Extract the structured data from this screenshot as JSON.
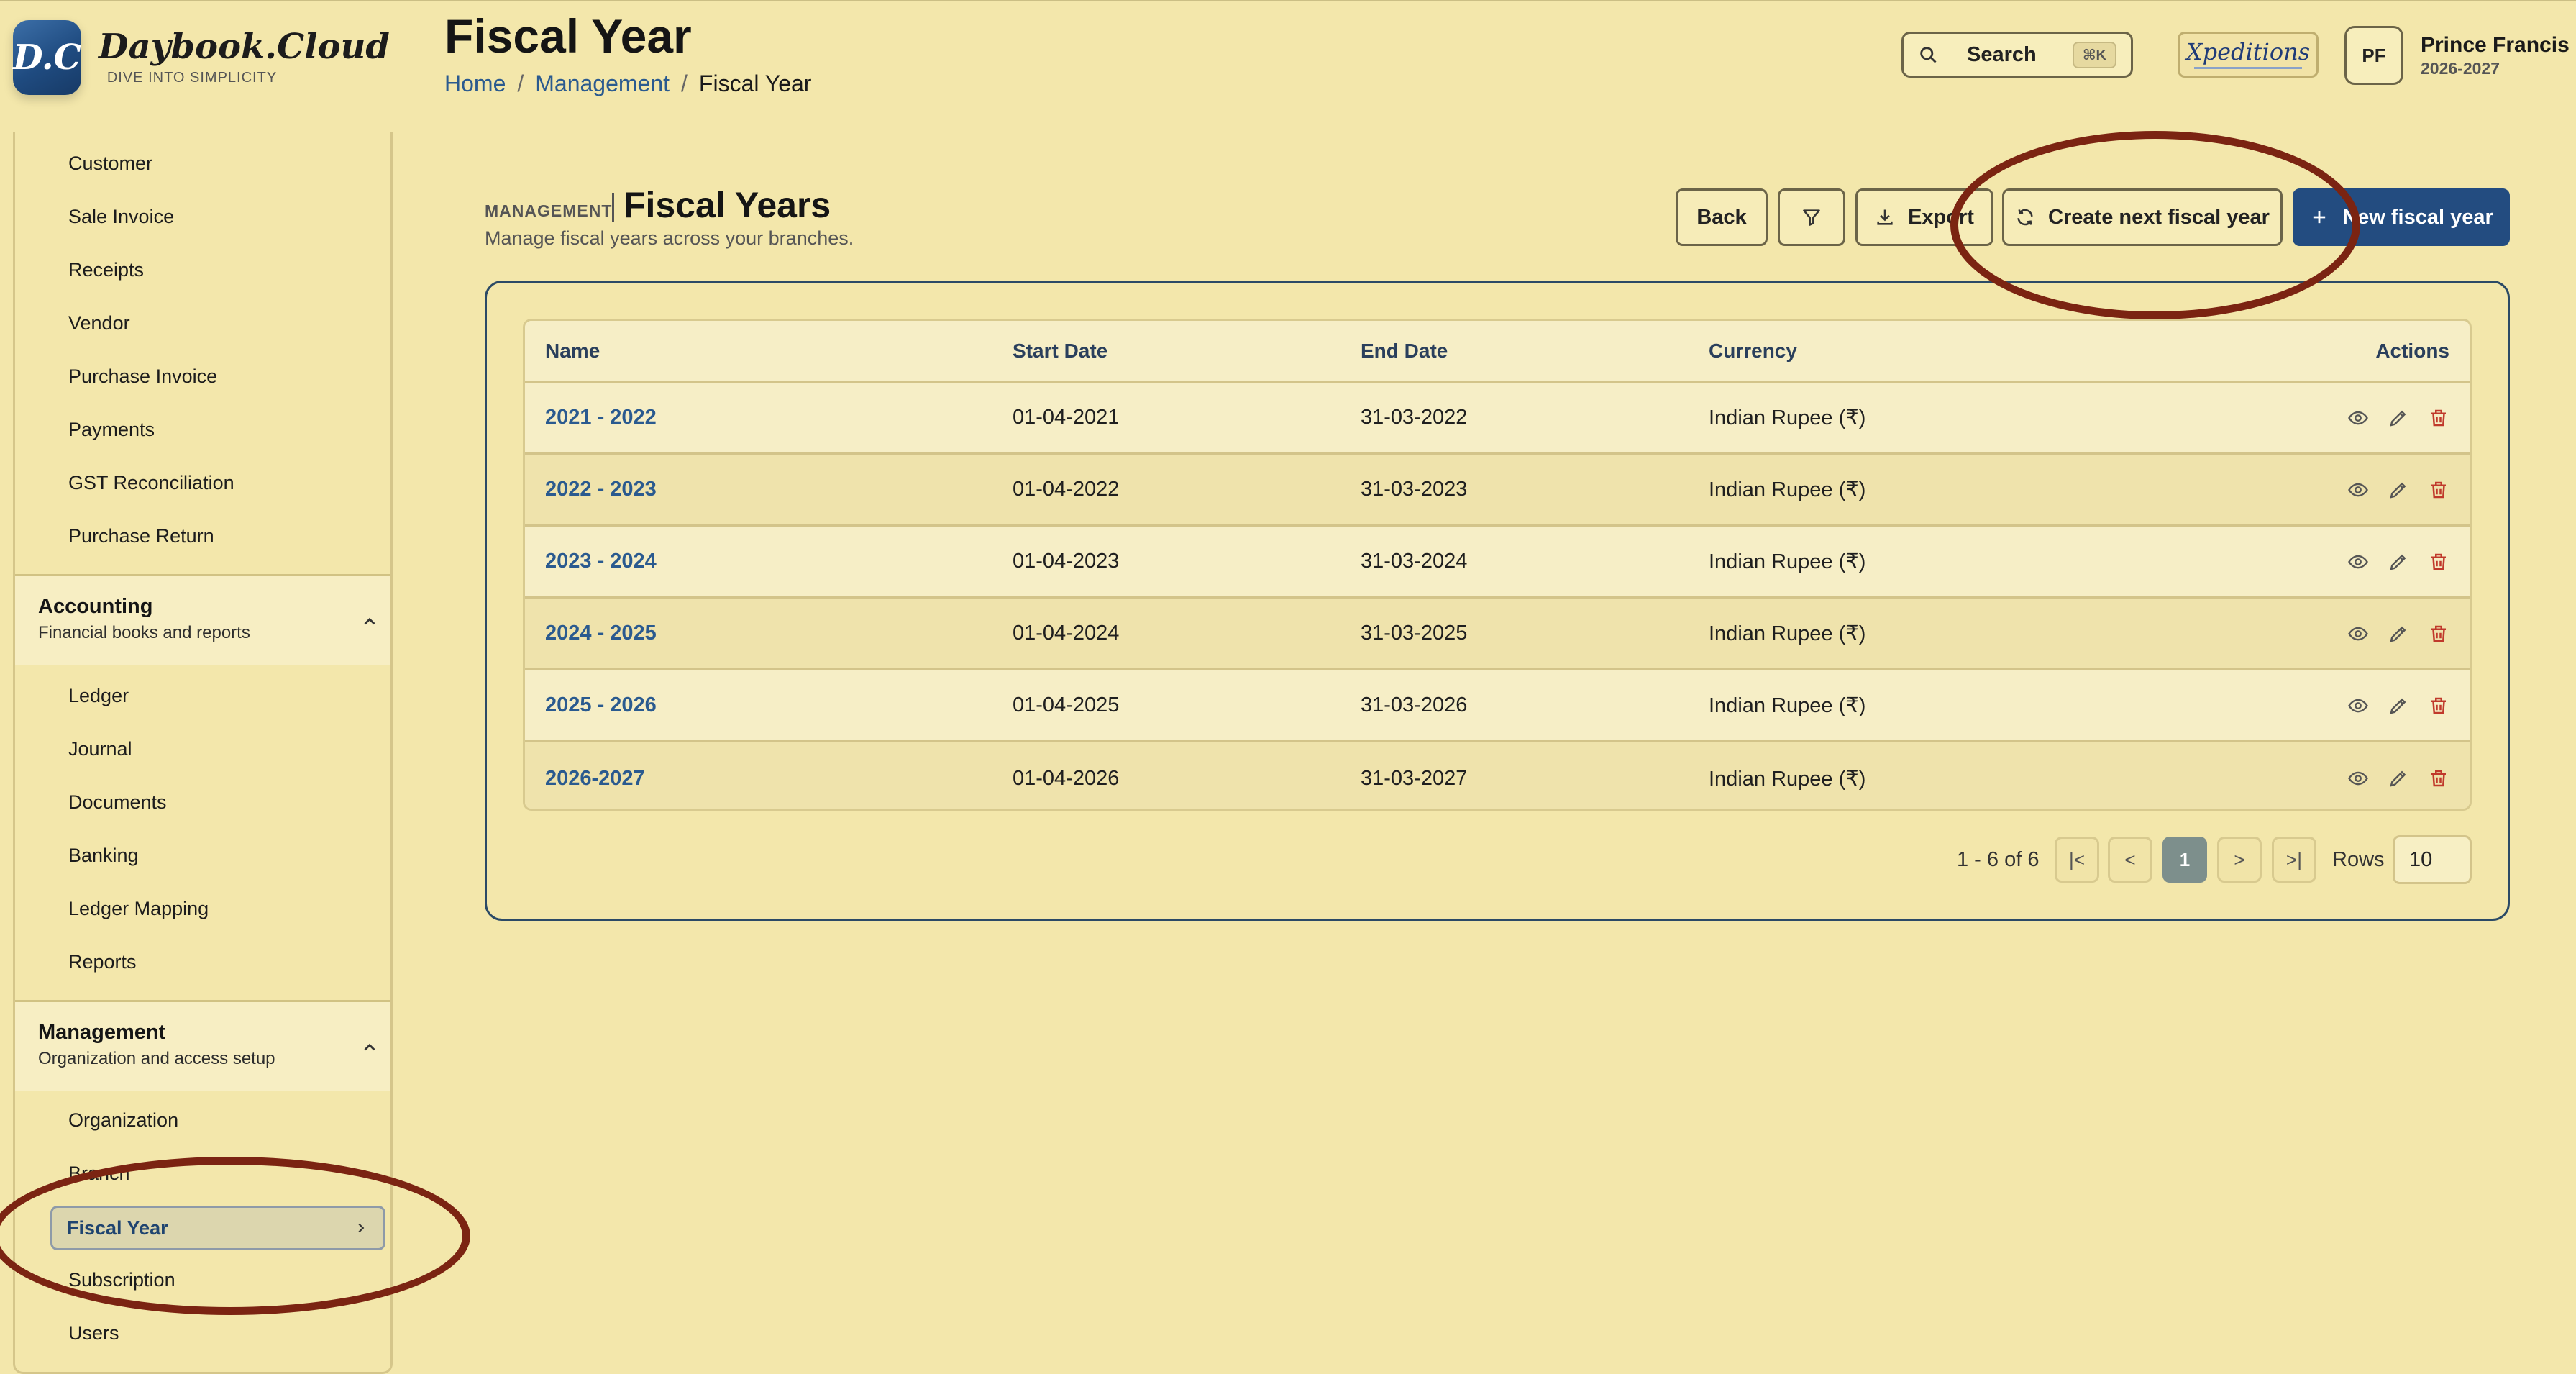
{
  "app": {
    "logo_mark": "D.C",
    "logo_name": "Daybook.Cloud",
    "logo_tagline": "DIVE INTO SIMPLICITY"
  },
  "header": {
    "title": "Fiscal Year",
    "breadcrumb": [
      "Home",
      "Management",
      "Fiscal Year"
    ],
    "search_label": "Search",
    "search_shortcut": "⌘K",
    "brand_badge": "Xpeditions",
    "user_initials": "PF",
    "user_name": "Prince Francis",
    "user_year": "2026-2027"
  },
  "sidebar": {
    "top_items": [
      "Customer",
      "Sale Invoice",
      "Receipts",
      "Vendor",
      "Purchase Invoice",
      "Payments",
      "GST Reconciliation",
      "Purchase Return"
    ],
    "accounting": {
      "title": "Accounting",
      "subtitle": "Financial books and reports",
      "items": [
        "Ledger",
        "Journal",
        "Documents",
        "Banking",
        "Ledger Mapping",
        "Reports"
      ]
    },
    "management": {
      "title": "Management",
      "subtitle": "Organization and access setup",
      "items": [
        "Organization",
        "Branch",
        "Fiscal Year",
        "Subscription",
        "Users"
      ],
      "active": "Fiscal Year"
    }
  },
  "main": {
    "kicker": "MANAGEMENT",
    "heading": "Fiscal Years",
    "subheading": "Manage fiscal years across your branches.",
    "buttons": {
      "back": "Back",
      "export": "Export",
      "create_next": "Create next fiscal year",
      "new": "New fiscal year"
    },
    "table": {
      "columns": [
        "Name",
        "Start Date",
        "End Date",
        "Currency",
        "Actions"
      ],
      "rows": [
        {
          "name": "2021 - 2022",
          "start": "01-04-2021",
          "end": "31-03-2022",
          "currency": "Indian Rupee (₹)"
        },
        {
          "name": "2022 - 2023",
          "start": "01-04-2022",
          "end": "31-03-2023",
          "currency": "Indian Rupee (₹)"
        },
        {
          "name": "2023 - 2024",
          "start": "01-04-2023",
          "end": "31-03-2024",
          "currency": "Indian Rupee (₹)"
        },
        {
          "name": "2024 - 2025",
          "start": "01-04-2024",
          "end": "31-03-2025",
          "currency": "Indian Rupee (₹)"
        },
        {
          "name": "2025 - 2026",
          "start": "01-04-2025",
          "end": "31-03-2026",
          "currency": "Indian Rupee (₹)"
        },
        {
          "name": "2026-2027",
          "start": "01-04-2026",
          "end": "31-03-2027",
          "currency": "Indian Rupee (₹)"
        }
      ]
    },
    "pagination": {
      "info": "1 - 6 of 6",
      "first": "|<",
      "prev": "<",
      "current": "1",
      "next": ">",
      "last": ">|",
      "rows_label": "Rows",
      "rows_value": "10"
    }
  },
  "colors": {
    "background": "#f3e7ab",
    "primary": "#234c80",
    "link": "#2a5a8f",
    "danger": "#c0392b",
    "annotation": "#7b2412"
  }
}
